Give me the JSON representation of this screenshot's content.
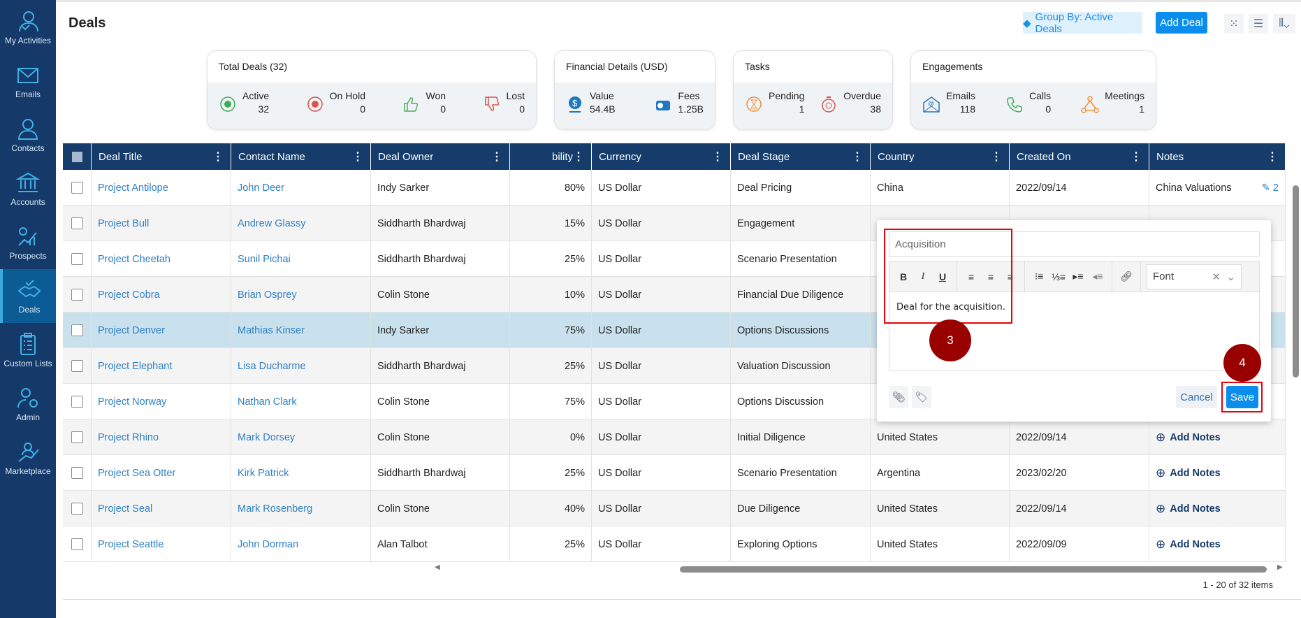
{
  "sidebar": {
    "items": [
      {
        "label": "My Activities",
        "icon": "user-check-icon"
      },
      {
        "label": "Emails",
        "icon": "envelope-icon"
      },
      {
        "label": "Contacts",
        "icon": "person-icon"
      },
      {
        "label": "Accounts",
        "icon": "bank-icon"
      },
      {
        "label": "Prospects",
        "icon": "chart-gear-icon"
      },
      {
        "label": "Deals",
        "icon": "handshake-icon",
        "active": true
      },
      {
        "label": "Custom Lists",
        "icon": "clipboard-list-icon"
      },
      {
        "label": "Admin",
        "icon": "user-gear-icon"
      },
      {
        "label": "Marketplace",
        "icon": "growth-icon"
      }
    ]
  },
  "header": {
    "title": "Deals",
    "group_by": "Group By: Active Deals",
    "add_deal": "Add Deal"
  },
  "cards": {
    "total": {
      "title": "Total Deals (32)",
      "stats": [
        {
          "label": "Active",
          "value": "32",
          "color": "#3cae5a"
        },
        {
          "label": "On Hold",
          "value": "0",
          "color": "#d9534f"
        },
        {
          "label": "Won",
          "value": "0",
          "color": "#4cb05f"
        },
        {
          "label": "Lost",
          "value": "0",
          "color": "#d9534f"
        }
      ]
    },
    "financial": {
      "title": "Financial Details (USD)",
      "stats": [
        {
          "label": "Value",
          "value": "54.4B"
        },
        {
          "label": "Fees",
          "value": "1.25B"
        }
      ]
    },
    "tasks": {
      "title": "Tasks",
      "stats": [
        {
          "label": "Pending",
          "value": "1"
        },
        {
          "label": "Overdue",
          "value": "38"
        }
      ]
    },
    "engagements": {
      "title": "Engagements",
      "stats": [
        {
          "label": "Emails",
          "value": "118"
        },
        {
          "label": "Calls",
          "value": "0"
        },
        {
          "label": "Meetings",
          "value": "1"
        }
      ]
    }
  },
  "table": {
    "columns": [
      "Deal Title",
      "Contact Name",
      "Deal Owner",
      "bility",
      "Currency",
      "Deal Stage",
      "Country",
      "Created On",
      "Notes"
    ],
    "rows": [
      {
        "title": "Project Antilope",
        "contact": "John Deer",
        "owner": "Indy Sarker",
        "prob": "80%",
        "currency": "US Dollar",
        "stage": "Deal Pricing",
        "country": "China",
        "created": "2022/09/14",
        "notes": "China Valuations",
        "notes_count": "2"
      },
      {
        "title": "Project Bull",
        "contact": "Andrew Glassy",
        "owner": "Siddharth Bhardwaj",
        "prob": "15%",
        "currency": "US Dollar",
        "stage": "Engagement"
      },
      {
        "title": "Project Cheetah",
        "contact": "Sunil Pichai",
        "owner": "Siddharth Bhardwaj",
        "prob": "25%",
        "currency": "US Dollar",
        "stage": "Scenario Presentation"
      },
      {
        "title": "Project Cobra",
        "contact": "Brian Osprey",
        "owner": "Colin Stone",
        "prob": "10%",
        "currency": "US Dollar",
        "stage": "Financial Due Diligence"
      },
      {
        "title": "Project Denver",
        "contact": "Mathias Kinser",
        "owner": "Indy Sarker",
        "prob": "75%",
        "currency": "US Dollar",
        "stage": "Options Discussions",
        "selected": true
      },
      {
        "title": "Project Elephant",
        "contact": "Lisa Ducharme",
        "owner": "Siddharth Bhardwaj",
        "prob": "25%",
        "currency": "US Dollar",
        "stage": "Valuation Discussion"
      },
      {
        "title": "Project Norway",
        "contact": "Nathan Clark",
        "owner": "Colin Stone",
        "prob": "75%",
        "currency": "US Dollar",
        "stage": "Options Discussion"
      },
      {
        "title": "Project Rhino",
        "contact": "Mark Dorsey",
        "owner": "Colin Stone",
        "prob": "0%",
        "currency": "US Dollar",
        "stage": "Initial Diligence",
        "country": "United States",
        "created": "2022/09/14",
        "add_notes": "Add Notes"
      },
      {
        "title": "Project Sea Otter",
        "contact": "Kirk Patrick",
        "owner": "Siddharth Bhardwaj",
        "prob": "25%",
        "currency": "US Dollar",
        "stage": "Scenario Presentation",
        "country": "Argentina",
        "created": "2023/02/20",
        "add_notes": "Add Notes"
      },
      {
        "title": "Project Seal",
        "contact": "Mark Rosenberg",
        "owner": "Colin Stone",
        "prob": "40%",
        "currency": "US Dollar",
        "stage": "Due Diligence",
        "country": "United States",
        "created": "2022/09/14",
        "add_notes": "Add Notes"
      },
      {
        "title": "Project Seattle",
        "contact": "John Dorman",
        "owner": "Alan Talbot",
        "prob": "25%",
        "currency": "US Dollar",
        "stage": "Exploring Options",
        "country": "United States",
        "created": "2022/09/09",
        "add_notes": "Add Notes"
      }
    ],
    "pager": "1 - 20 of 32 items"
  },
  "note_popup": {
    "title_value": "Acquisition",
    "body": "Deal for the acquisition.",
    "font_placeholder": "Font",
    "cancel": "Cancel",
    "save": "Save"
  },
  "annotations": {
    "step3": "3",
    "step4": "4",
    "color": "#990000"
  }
}
